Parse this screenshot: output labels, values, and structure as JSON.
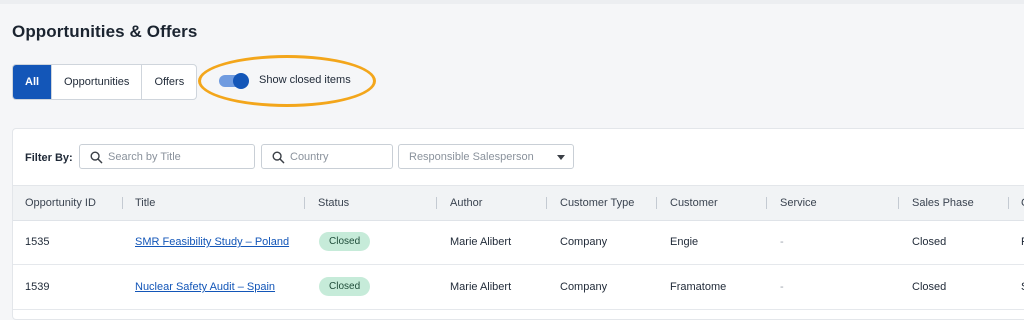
{
  "page": {
    "title": "Opportunities & Offers"
  },
  "segments": [
    {
      "label": "All",
      "active": true
    },
    {
      "label": "Opportunities",
      "active": false
    },
    {
      "label": "Offers",
      "active": false
    }
  ],
  "toggle": {
    "label": "Show closed items",
    "on": true
  },
  "colors": {
    "primary": "#1356b8",
    "highlight": "#f3a61b",
    "badge_bg": "#c6ebd9"
  },
  "filters": {
    "label": "Filter By:",
    "title_placeholder": "Search by Title",
    "country_placeholder": "Country",
    "salesperson_placeholder": "Responsible Salesperson"
  },
  "table": {
    "columns": [
      "Opportunity ID",
      "Title",
      "Status",
      "Author",
      "Customer Type",
      "Customer",
      "Service",
      "Sales Phase",
      "C"
    ],
    "rows": [
      {
        "id": "1535",
        "title": "SMR Feasibility Study – Poland",
        "status": "Closed",
        "author": "Marie Alibert",
        "customer_type": "Company",
        "customer": "Engie",
        "service": "-",
        "sales_phase": "Closed",
        "extra": "F"
      },
      {
        "id": "1539",
        "title": "Nuclear Safety Audit – Spain",
        "status": "Closed",
        "author": "Marie Alibert",
        "customer_type": "Company",
        "customer": "Framatome",
        "service": "-",
        "sales_phase": "Closed",
        "extra": "S"
      }
    ]
  },
  "icons": {
    "search": "search-icon",
    "dropdown": "chevron-down-icon"
  }
}
